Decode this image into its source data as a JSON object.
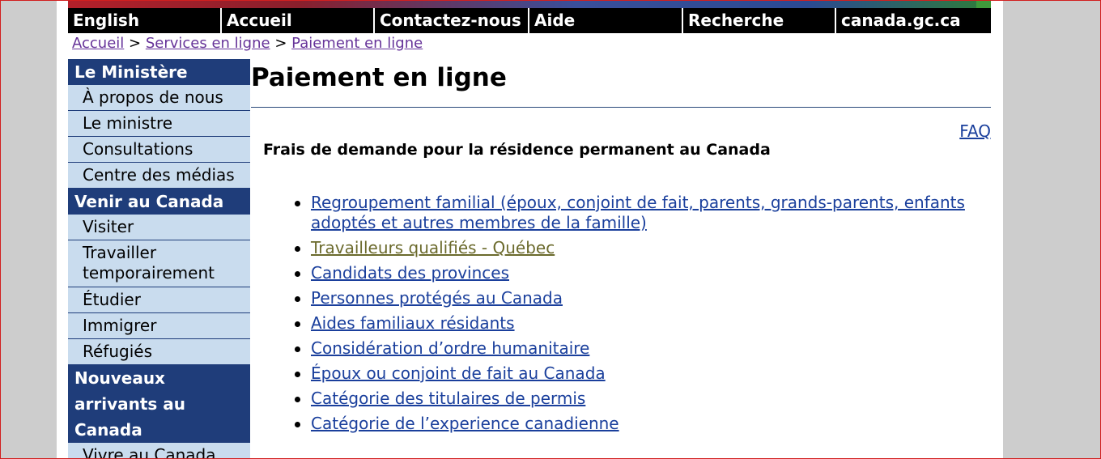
{
  "nav": {
    "items": [
      "English",
      "Accueil",
      "Contactez-nous",
      "Aide",
      "Recherche",
      "canada.gc.ca"
    ]
  },
  "breadcrumb": {
    "items": [
      "Accueil",
      "Services en ligne",
      "Paiement en ligne"
    ],
    "separator": ">"
  },
  "sidebar": {
    "section1": {
      "title": "Le Ministère",
      "items": [
        "À propos de nous",
        "Le ministre",
        "Consultations",
        "Centre des médias"
      ]
    },
    "section2": {
      "title": "Venir au Canada",
      "items": [
        "Visiter",
        "Travailler temporairement",
        "Étudier",
        "Immigrer",
        "Réfugiés"
      ]
    },
    "section3": {
      "title": "Nouveaux arrivants au Canada",
      "items": [
        "Vivre au Canada"
      ]
    }
  },
  "main": {
    "title": "Paiement en ligne",
    "faq": "FAQ",
    "subheading": "Frais de demande pour la résidence permanent au Canada",
    "links": [
      "Regroupement familial (époux, conjoint de fait, parents, grands-parents, enfants adoptés et autres membres de la famille)",
      "Travailleurs qualifiés - Québec",
      "Candidats des provinces",
      "Personnes protégés au Canada",
      "Aides familiaux résidants",
      "Considération d’ordre humanitaire",
      "Époux ou conjoint de fait au Canada",
      "Catégorie des titulaires de permis",
      "Catégorie de l’experience canadienne"
    ]
  },
  "colors": {
    "nav_bg": "#000000",
    "sidebar_header": "#1f3d7a",
    "sidebar_item": "#c9dcee",
    "link": "#1a3f9c",
    "visited_link": "#6b6a2c",
    "breadcrumb_link": "#663399"
  }
}
